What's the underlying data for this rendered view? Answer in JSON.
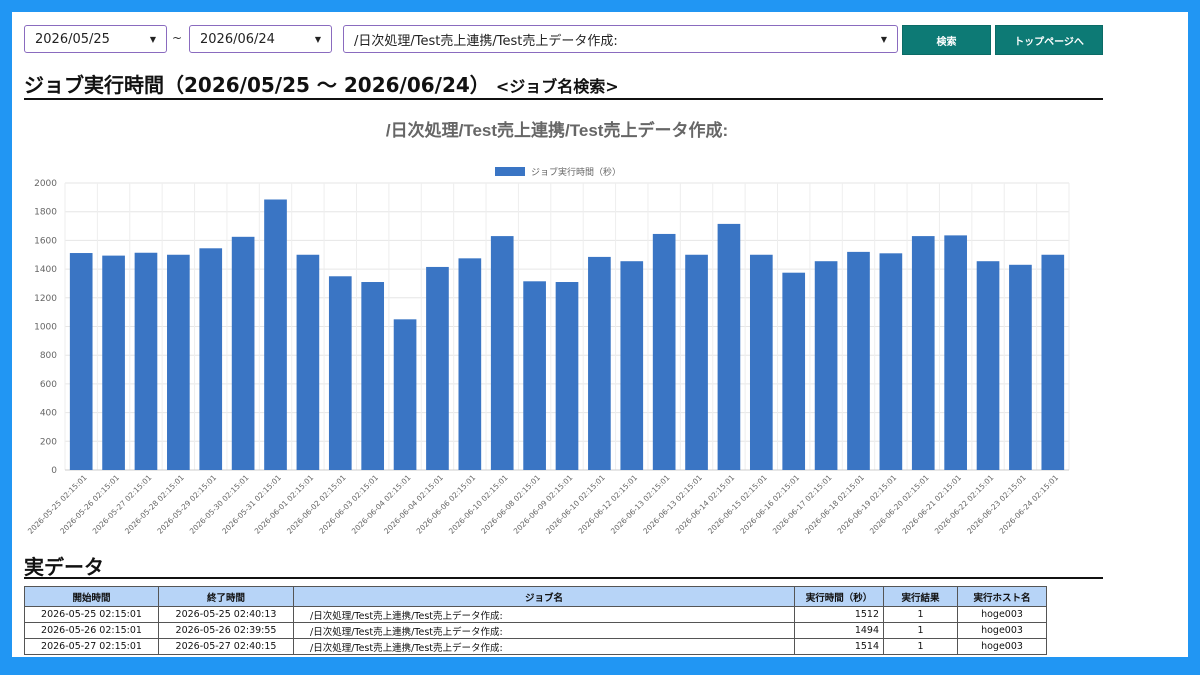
{
  "filters": {
    "start_date": "2026/05/25",
    "separator": "~",
    "end_date": "2026/06/24",
    "job_name": "/日次処理/Test売上連携/Test売上データ作成:",
    "search_label": "検索",
    "top_page_label": "トップページへ"
  },
  "page_heading": {
    "title": "ジョブ実行時間（2026/05/25 ～ 2026/06/24）",
    "subtitle": "<ジョブ名検索>"
  },
  "chart_data": {
    "type": "bar",
    "title": "/日次処理/Test売上連携/Test売上データ作成:",
    "legend_position": "top",
    "grid": true,
    "ylim": [
      0,
      2000
    ],
    "yticks": [
      0,
      200,
      400,
      600,
      800,
      1000,
      1200,
      1400,
      1600,
      1800,
      2000
    ],
    "categories": [
      "2026-05-25 02:15:01",
      "2026-05-26 02:15:01",
      "2026-05-27 02:15:01",
      "2026-05-28 02:15:01",
      "2026-05-29 02:15:01",
      "2026-05-30 02:15:01",
      "2026-05-31 02:15:01",
      "2026-06-01 02:15:01",
      "2026-06-02 02:15:01",
      "2026-06-03 02:15:01",
      "2026-06-04 02:15:01",
      "2026-06-04 02:15:01",
      "2026-06-06 02:15:01",
      "2026-06-10 02:15:01",
      "2026-06-08 02:15:01",
      "2026-06-09 02:15:01",
      "2026-06-10 02:15:01",
      "2026-06-12 02:15:01",
      "2026-06-13 02:15:01",
      "2026-06-13 02:15:01",
      "2026-06-14 02:15:01",
      "2026-06-15 02:15:01",
      "2026-06-16 02:15:01",
      "2026-06-17 02:15:01",
      "2026-06-18 02:15:01",
      "2026-06-19 02:15:01",
      "2026-06-20 02:15:01",
      "2026-06-21 02:15:01",
      "2026-06-22 02:15:01",
      "2026-06-23 02:15:01",
      "2026-06-24 02:15:01"
    ],
    "series": [
      {
        "name": "ジョブ実行時間（秒）",
        "color": "#3a75c4",
        "values": [
          1512,
          1494,
          1514,
          1500,
          1545,
          1625,
          1885,
          1500,
          1350,
          1310,
          1050,
          1415,
          1475,
          1630,
          1315,
          1310,
          1485,
          1455,
          1645,
          1500,
          1715,
          1500,
          1375,
          1455,
          1520,
          1510,
          1630,
          1635,
          1455,
          1430,
          1500
        ]
      }
    ]
  },
  "results": {
    "heading": "実データ",
    "columns": [
      "開始時間",
      "終了時間",
      "ジョブ名",
      "実行時間（秒）",
      "実行結果",
      "実行ホスト名"
    ],
    "rows": [
      [
        "2026-05-25 02:15:01",
        "2026-05-25 02:40:13",
        "/日次処理/Test売上連携/Test売上データ作成:",
        "1512",
        "1",
        "hoge003"
      ],
      [
        "2026-05-26 02:15:01",
        "2026-05-26 02:39:55",
        "/日次処理/Test売上連携/Test売上データ作成:",
        "1494",
        "1",
        "hoge003"
      ],
      [
        "2026-05-27 02:15:01",
        "2026-05-27 02:40:15",
        "/日次処理/Test売上連携/Test売上データ作成:",
        "1514",
        "1",
        "hoge003"
      ]
    ]
  }
}
